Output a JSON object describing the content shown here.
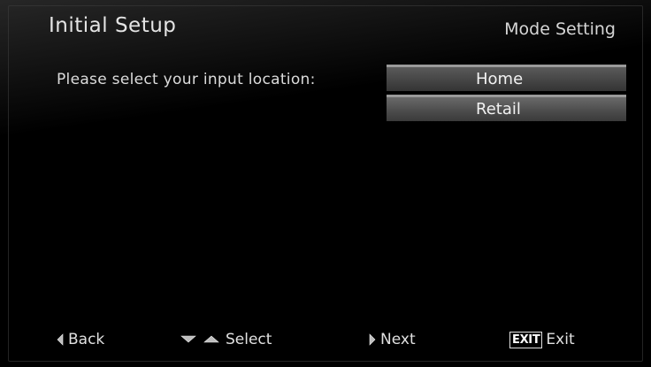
{
  "header": {
    "title": "Initial Setup",
    "subtitle": "Mode Setting"
  },
  "prompt": "Please select your input location:",
  "options": [
    {
      "label": "Home",
      "selected": true
    },
    {
      "label": "Retail",
      "selected": false
    }
  ],
  "footer": {
    "back": {
      "label": "Back",
      "icon": "left-arrow-icon"
    },
    "select": {
      "label": "Select",
      "icon": "up-down-arrows-icon"
    },
    "next": {
      "label": "Next",
      "icon": "right-arrow-icon"
    },
    "exit": {
      "label": "Exit",
      "key_label": "EXIT"
    }
  }
}
